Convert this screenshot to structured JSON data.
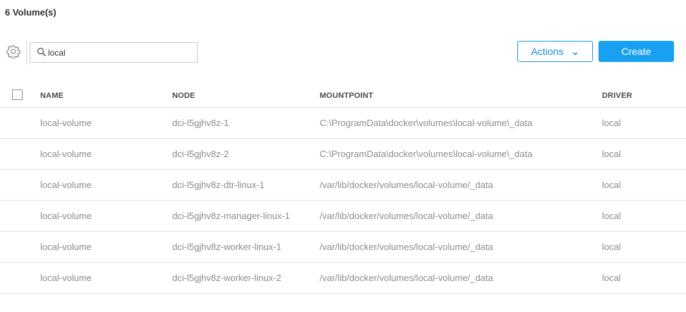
{
  "header": {
    "title": "6 Volume(s)"
  },
  "toolbar": {
    "settings_icon": "gear-icon",
    "search_icon": "search-icon",
    "search_value": "local",
    "actions_label": "Actions",
    "create_label": "Create",
    "accent_color": "#1aa0f0"
  },
  "table": {
    "columns": {
      "name": "NAME",
      "node": "NODE",
      "mountpoint": "MOUNTPOINT",
      "driver": "DRIVER"
    },
    "rows": [
      {
        "name": "local-volume",
        "node": "dci-l5gjhv8z-1",
        "mountpoint": "C:\\ProgramData\\docker\\volumes\\local-volume\\_data",
        "driver": "local"
      },
      {
        "name": "local-volume",
        "node": "dci-l5gjhv8z-2",
        "mountpoint": "C:\\ProgramData\\docker\\volumes\\local-volume\\_data",
        "driver": "local"
      },
      {
        "name": "local-volume",
        "node": "dci-l5gjhv8z-dtr-linux-1",
        "mountpoint": "/var/lib/docker/volumes/local-volume/_data",
        "driver": "local"
      },
      {
        "name": "local-volume",
        "node": "dci-l5gjhv8z-manager-linux-1",
        "mountpoint": "/var/lib/docker/volumes/local-volume/_data",
        "driver": "local"
      },
      {
        "name": "local-volume",
        "node": "dci-l5gjhv8z-worker-linux-1",
        "mountpoint": "/var/lib/docker/volumes/local-volume/_data",
        "driver": "local"
      },
      {
        "name": "local-volume",
        "node": "dci-l5gjhv8z-worker-linux-2",
        "mountpoint": "/var/lib/docker/volumes/local-volume/_data",
        "driver": "local"
      }
    ]
  }
}
